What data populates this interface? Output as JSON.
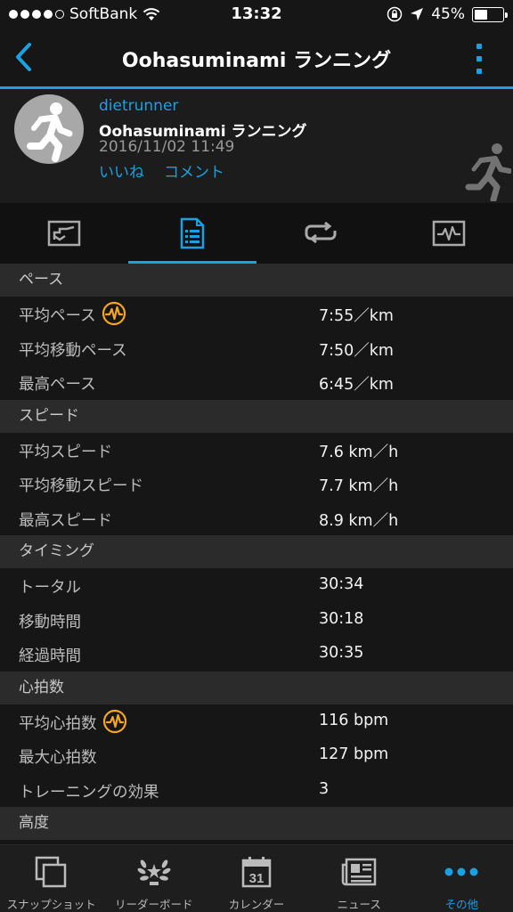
{
  "status_bar": {
    "carrier": "SoftBank",
    "time": "13:32",
    "battery": "45%",
    "battery_level": 0.45
  },
  "nav": {
    "title": "Oohasuminami ランニング"
  },
  "activity": {
    "user": "dietrunner",
    "name": "Oohasuminami ランニング",
    "datetime": "2016/11/02 11:49",
    "like": "いいね",
    "comment": "コメント"
  },
  "sections": [
    {
      "title": "ペース",
      "rows": [
        {
          "label": "平均ペース",
          "value": "7:55／km",
          "hr_badge": true
        },
        {
          "label": "平均移動ペース",
          "value": "7:50／km",
          "hr_badge": false
        },
        {
          "label": "最高ペース",
          "value": "6:45／km",
          "hr_badge": false
        }
      ]
    },
    {
      "title": "スピード",
      "rows": [
        {
          "label": "平均スピード",
          "value": "7.6 km／h",
          "hr_badge": false
        },
        {
          "label": "平均移動スピード",
          "value": "7.7 km／h",
          "hr_badge": false
        },
        {
          "label": "最高スピード",
          "value": "8.9 km／h",
          "hr_badge": false
        }
      ]
    },
    {
      "title": "タイミング",
      "rows": [
        {
          "label": "トータル",
          "value": "30:34",
          "hr_badge": false
        },
        {
          "label": "移動時間",
          "value": "30:18",
          "hr_badge": false
        },
        {
          "label": "経過時間",
          "value": "30:35",
          "hr_badge": false
        }
      ]
    },
    {
      "title": "心拍数",
      "rows": [
        {
          "label": "平均心拍数",
          "value": "116 bpm",
          "hr_badge": true
        },
        {
          "label": "最大心拍数",
          "value": "127 bpm",
          "hr_badge": false
        },
        {
          "label": "トレーニングの効果",
          "value": "3",
          "hr_badge": false
        }
      ]
    },
    {
      "title": "高度",
      "rows": []
    }
  ],
  "bottom_tabs": [
    {
      "label": "スナップショット",
      "icon": "snapshot-icon"
    },
    {
      "label": "リーダーボード",
      "icon": "laurel-icon"
    },
    {
      "label": "カレンダー",
      "icon": "calendar-icon",
      "day": "31"
    },
    {
      "label": "ニュース",
      "icon": "news-icon"
    },
    {
      "label": "その他",
      "icon": "more-dots-icon"
    }
  ],
  "colors": {
    "accent": "#1ba1e2",
    "badge": "#f5a623"
  }
}
